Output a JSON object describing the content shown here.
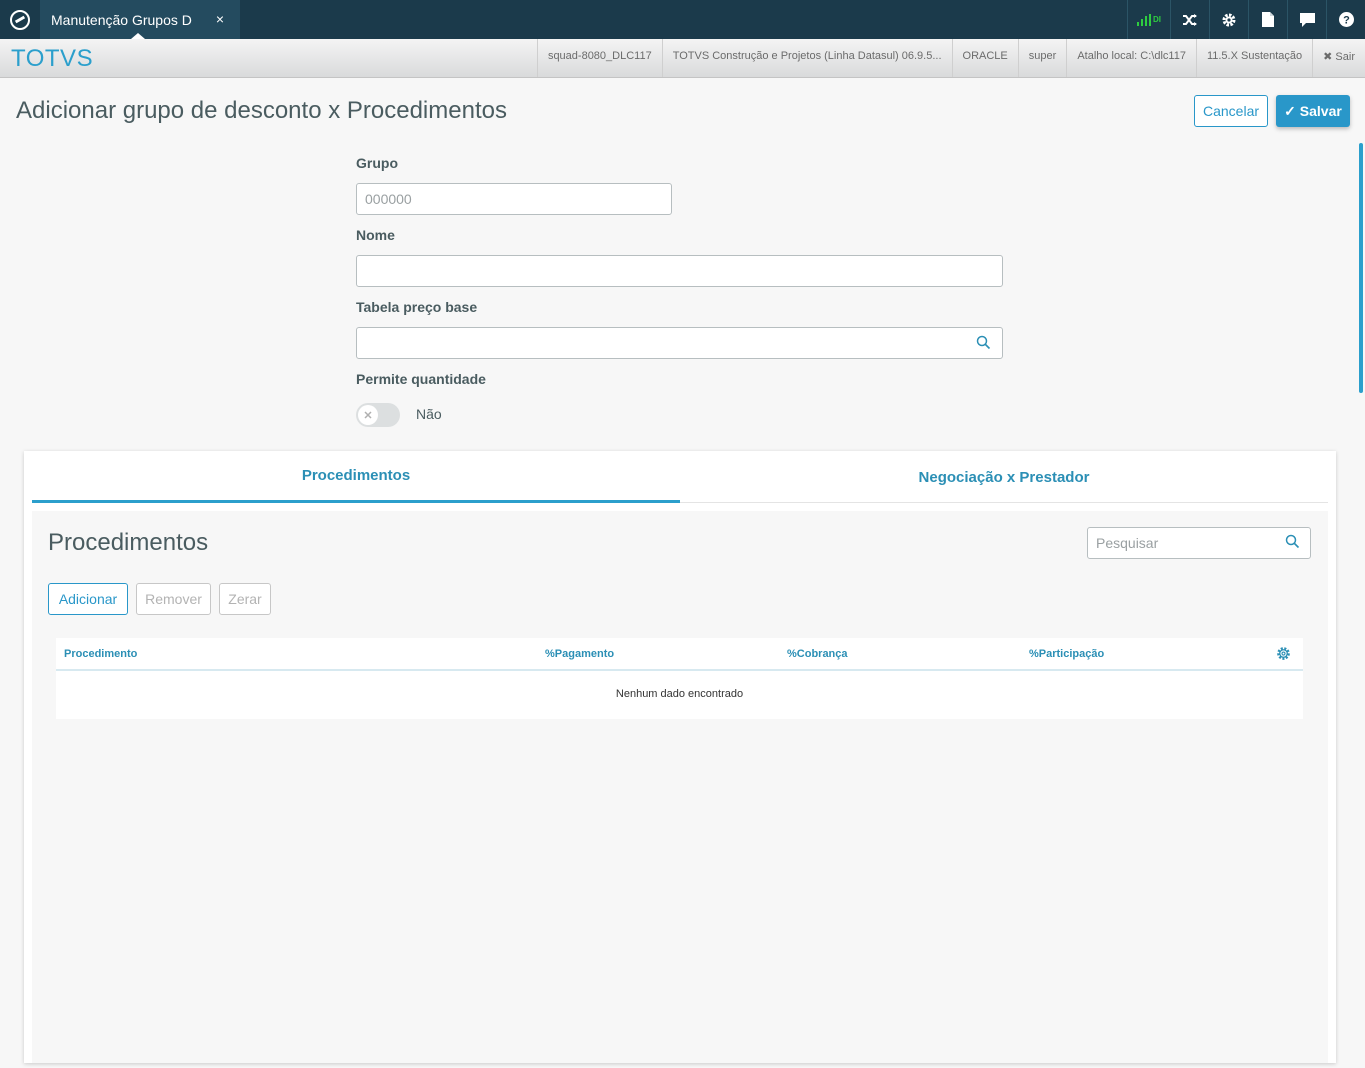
{
  "topbar": {
    "tab_title": "Manutenção Grupos D",
    "tab_close": "×",
    "signal_label": "DI"
  },
  "header": {
    "brand": "TOTVS",
    "info": [
      "squad-8080_DLC117",
      "TOTVS Construção e Projetos (Linha Datasul) 06.9.5...",
      "ORACLE",
      "super",
      "Atalho local: C:\\dlc117",
      "11.5.X Sustentação"
    ],
    "logout_label": "✖ Sair"
  },
  "page": {
    "title": "Adicionar grupo de desconto x Procedimentos",
    "cancel_label": "Cancelar",
    "save_label": "✓ Salvar"
  },
  "form": {
    "grupo_label": "Grupo",
    "grupo_placeholder": "000000",
    "nome_label": "Nome",
    "tabela_label": "Tabela preço base",
    "permite_label": "Permite quantidade",
    "permite_value": "Não"
  },
  "tabs": [
    {
      "label": "Procedimentos",
      "active": true
    },
    {
      "label": "Negociação x Prestador",
      "active": false
    }
  ],
  "section": {
    "title": "Procedimentos",
    "search_placeholder": "Pesquisar",
    "add_label": "Adicionar",
    "remove_label": "Remover",
    "reset_label": "Zerar"
  },
  "table": {
    "columns": [
      "Procedimento",
      "%Pagamento",
      "%Cobrança",
      "%Participação"
    ],
    "empty_message": "Nenhum dado encontrado"
  },
  "colors": {
    "primary": "#2997c9",
    "topbar": "#1b3a4b"
  }
}
